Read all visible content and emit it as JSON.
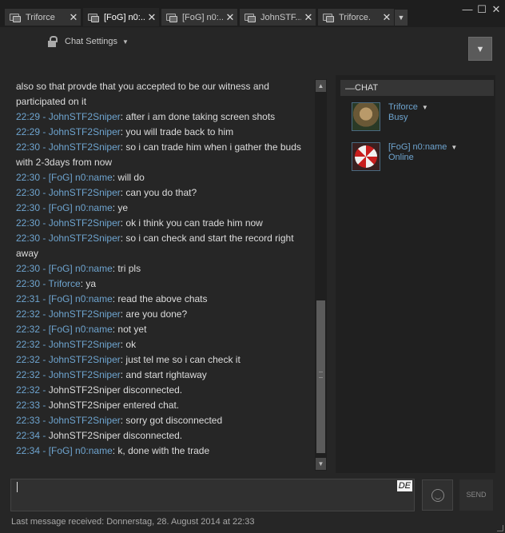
{
  "tabs": [
    {
      "label": "Triforce",
      "close": "✕"
    },
    {
      "label": "[FoG] n0:...",
      "close": "✕"
    },
    {
      "label": "[FoG] n0:...",
      "close": "✕"
    },
    {
      "label": "JohnSTF...",
      "close": "✕"
    },
    {
      "label": "Triforce.",
      "close": "✕"
    }
  ],
  "tab_overflow": "▼",
  "window_controls": {
    "minimize": "—",
    "maximize": "☐",
    "close": "✕"
  },
  "header": {
    "chat_settings_label": "Chat Settings",
    "caret": "▼",
    "menu_dropdown": "▼"
  },
  "messages": [
    {
      "ts": "",
      "sep": "",
      "name": "",
      "text": "also so that provde that you accepted to be our witness and participated on it"
    },
    {
      "ts": "22:29",
      "sep": " - ",
      "name": "JohnSTF2Sniper",
      "text": ": after i am done taking screen shots"
    },
    {
      "ts": "22:29",
      "sep": " - ",
      "name": "JohnSTF2Sniper",
      "text": ": you will trade back to him"
    },
    {
      "ts": "22:30",
      "sep": " - ",
      "name": "JohnSTF2Sniper",
      "text": ": so i can trade him when i gather the buds with 2-3days from now"
    },
    {
      "ts": "22:30",
      "sep": " - ",
      "name": "[FoG] n0:name",
      "text": ": will do"
    },
    {
      "ts": "22:30",
      "sep": " - ",
      "name": "JohnSTF2Sniper",
      "text": ": can you do that?"
    },
    {
      "ts": "22:30",
      "sep": " - ",
      "name": "[FoG] n0:name",
      "text": ": ye"
    },
    {
      "ts": "22:30",
      "sep": " - ",
      "name": "JohnSTF2Sniper",
      "text": ": ok i think you can trade him now"
    },
    {
      "ts": "22:30",
      "sep": " - ",
      "name": "JohnSTF2Sniper",
      "text": ": so i can check and start the record right away"
    },
    {
      "ts": "22:30",
      "sep": " - ",
      "name": "[FoG] n0:name",
      "text": ": tri pls"
    },
    {
      "ts": "22:30",
      "sep": " - ",
      "name": "Triforce",
      "text": ": ya"
    },
    {
      "ts": "22:31",
      "sep": " - ",
      "name": "[FoG] n0:name",
      "text": ": read the above chats"
    },
    {
      "ts": "22:32",
      "sep": " - ",
      "name": "JohnSTF2Sniper",
      "text": ": are you done?"
    },
    {
      "ts": "22:32",
      "sep": " - ",
      "name": "[FoG] n0:name",
      "text": ": not yet"
    },
    {
      "ts": "22:32",
      "sep": " - ",
      "name": "JohnSTF2Sniper",
      "text": ": ok"
    },
    {
      "ts": "22:32",
      "sep": " - ",
      "name": "JohnSTF2Sniper",
      "text": ": just tel me so i can check it"
    },
    {
      "ts": "22:32",
      "sep": " - ",
      "name": "JohnSTF2Sniper",
      "text": ": and start rightaway"
    },
    {
      "ts": "22:32",
      "sep": " - ",
      "name": "",
      "text": "JohnSTF2Sniper disconnected."
    },
    {
      "ts": "22:33",
      "sep": " - ",
      "name": "",
      "text": "JohnSTF2Sniper entered chat."
    },
    {
      "ts": "22:33",
      "sep": " - ",
      "name": "JohnSTF2Sniper",
      "text": ": sorry got disconnected"
    },
    {
      "ts": "22:34",
      "sep": " - ",
      "name": "",
      "text": "JohnSTF2Sniper disconnected."
    },
    {
      "ts": "22:34",
      "sep": " - ",
      "name": "[FoG] n0:name",
      "text": ": k, done with the trade"
    }
  ],
  "scrollbar": {
    "up": "▲",
    "down": "▼"
  },
  "right_panel": {
    "section_title": "CHAT",
    "collapse_glyph": "—",
    "friends": [
      {
        "name": "Triforce",
        "status": "Busy",
        "dd": "▼"
      },
      {
        "name": "[FoG] n0:name",
        "status": "Online",
        "dd": "▼"
      }
    ]
  },
  "input": {
    "value": "",
    "language_indicator": "DE"
  },
  "send_label": "SEND",
  "footer": {
    "status": "Last message received: Donnerstag, 28. August 2014 at 22:33"
  },
  "colors": {
    "name_blue": "#6ea4cf",
    "background": "#262626"
  }
}
